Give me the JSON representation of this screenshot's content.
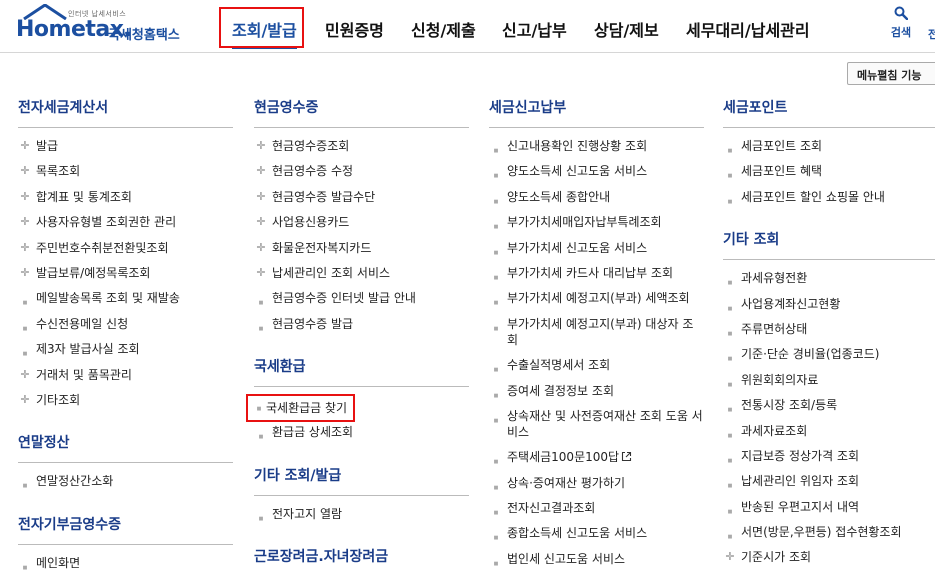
{
  "brand": {
    "logo_tag": "인터넷 납세서비스",
    "logo_text": "Hometax.",
    "service_name": "국세청홈택스",
    "accent_color": "#1c4fa0",
    "highlight_color": "#e81111"
  },
  "gnb": {
    "items": [
      {
        "label": "조회/발급",
        "active": true
      },
      {
        "label": "민원증명"
      },
      {
        "label": "신청/제출"
      },
      {
        "label": "신고/납부"
      },
      {
        "label": "상담/제보"
      },
      {
        "label": "세무대리/납세관리"
      }
    ],
    "search_label": "검색",
    "all_label": "전"
  },
  "menu_toggle_label": "메뉴펼침 기능",
  "columns": [
    {
      "sections": [
        {
          "title": "전자세금계산서",
          "items": [
            {
              "label": "발급",
              "marker": "plus"
            },
            {
              "label": "목록조회",
              "marker": "plus"
            },
            {
              "label": "합계표 및 통계조회",
              "marker": "plus"
            },
            {
              "label": "사용자유형별 조회권한 관리",
              "marker": "plus"
            },
            {
              "label": "주민번호수취분전환및조회",
              "marker": "plus"
            },
            {
              "label": "발급보류/예정목록조회",
              "marker": "plus"
            },
            {
              "label": "메일발송목록 조회 및 재발송",
              "marker": "dot"
            },
            {
              "label": "수신전용메일 신청",
              "marker": "dot"
            },
            {
              "label": "제3자 발급사실 조회",
              "marker": "dot"
            },
            {
              "label": "거래처 및 품목관리",
              "marker": "plus"
            },
            {
              "label": "기타조회",
              "marker": "plus"
            }
          ]
        },
        {
          "title": "연말정산",
          "items": [
            {
              "label": "연말정산간소화",
              "marker": "dot"
            }
          ]
        },
        {
          "title": "전자기부금영수증",
          "items": [
            {
              "label": "메인화면",
              "marker": "dot"
            }
          ]
        }
      ]
    },
    {
      "sections": [
        {
          "title": "현금영수증",
          "items": [
            {
              "label": "현금영수증조회",
              "marker": "plus"
            },
            {
              "label": "현금영수증 수정",
              "marker": "plus"
            },
            {
              "label": "현금영수증 발급수단",
              "marker": "plus"
            },
            {
              "label": "사업용신용카드",
              "marker": "plus"
            },
            {
              "label": "화물운전자복지카드",
              "marker": "plus"
            },
            {
              "label": "납세관리인 조회 서비스",
              "marker": "plus"
            },
            {
              "label": "현금영수증 인터넷 발급 안내",
              "marker": "dot"
            },
            {
              "label": "현금영수증 발급",
              "marker": "dot"
            }
          ]
        },
        {
          "title": "국세환급",
          "items": [
            {
              "label": "국세환급금 찾기",
              "marker": "dot",
              "highlighted": true
            },
            {
              "label": "환급금 상세조회",
              "marker": "dot"
            }
          ]
        },
        {
          "title": "기타 조회/발급",
          "items": [
            {
              "label": "전자고지 열람",
              "marker": "dot"
            }
          ]
        },
        {
          "title": "근로장려금.자녀장려금",
          "items": []
        }
      ]
    },
    {
      "sections": [
        {
          "title": "세금신고납부",
          "items": [
            {
              "label": "신고내용확인 진행상황 조회",
              "marker": "dot"
            },
            {
              "label": "양도소득세 신고도움 서비스",
              "marker": "dot"
            },
            {
              "label": "양도소득세 종합안내",
              "marker": "dot"
            },
            {
              "label": "부가가치세매입자납부특례조회",
              "marker": "dot"
            },
            {
              "label": "부가가치세 신고도움 서비스",
              "marker": "dot"
            },
            {
              "label": "부가가치세 카드사 대리납부 조회",
              "marker": "dot"
            },
            {
              "label": "부가가치세 예정고지(부과) 세액조회",
              "marker": "dot"
            },
            {
              "label": "부가가치세 예정고지(부과) 대상자 조회",
              "marker": "dot",
              "wrap": true
            },
            {
              "label": "수출실적명세서 조회",
              "marker": "dot"
            },
            {
              "label": "증여세 결정정보 조회",
              "marker": "dot"
            },
            {
              "label": "상속재산 및 사전증여재산 조회 도움 서비스",
              "marker": "dot",
              "wrap": true
            },
            {
              "label": "주택세금100문100답",
              "marker": "dot",
              "external": true
            },
            {
              "label": "상속·증여재산 평가하기",
              "marker": "dot"
            },
            {
              "label": "전자신고결과조회",
              "marker": "dot"
            },
            {
              "label": "종합소득세 신고도움 서비스",
              "marker": "dot"
            },
            {
              "label": "법인세 신고도움 서비스",
              "marker": "dot"
            }
          ]
        }
      ]
    },
    {
      "sections": [
        {
          "title": "세금포인트",
          "items": [
            {
              "label": "세금포인트 조회",
              "marker": "dot"
            },
            {
              "label": "세금포인트 혜택",
              "marker": "dot"
            },
            {
              "label": "세금포인트 할인 쇼핑몰 안내",
              "marker": "dot"
            }
          ]
        },
        {
          "title": "기타 조회",
          "items": [
            {
              "label": "과세유형전환",
              "marker": "dot"
            },
            {
              "label": "사업용계좌신고현황",
              "marker": "dot"
            },
            {
              "label": "주류면허상태",
              "marker": "dot"
            },
            {
              "label": "기준·단순 경비율(업종코드)",
              "marker": "dot"
            },
            {
              "label": "위원회회의자료",
              "marker": "dot"
            },
            {
              "label": "전통시장 조회/등록",
              "marker": "dot"
            },
            {
              "label": "과세자료조회",
              "marker": "dot"
            },
            {
              "label": "지급보증 정상가격 조회",
              "marker": "dot"
            },
            {
              "label": "납세관리인 위임자 조회",
              "marker": "dot"
            },
            {
              "label": "반송된 우편고지서 내역",
              "marker": "dot"
            },
            {
              "label": "서면(방문,우편등) 접수현황조회",
              "marker": "dot"
            },
            {
              "label": "기준시가 조회",
              "marker": "plus"
            }
          ]
        }
      ]
    }
  ]
}
